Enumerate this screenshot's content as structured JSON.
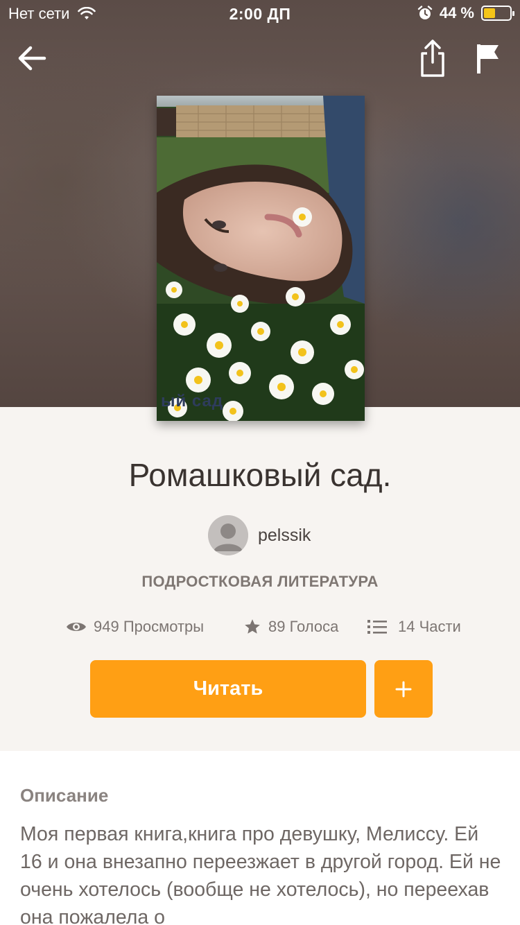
{
  "status_bar": {
    "carrier": "Нет сети",
    "time": "2:00 ДП",
    "battery_percent": "44 %",
    "battery_level": 0.44
  },
  "nav": {
    "back_icon": "arrow-left-icon",
    "share_icon": "share-icon",
    "report_icon": "flag-icon"
  },
  "cover": {
    "caption": "ый сад"
  },
  "book": {
    "title": "Ромашковый сад.",
    "author": "pelssik",
    "category": "ПОДРОСТКОВАЯ ЛИТЕРАТУРА"
  },
  "stats": {
    "views": "949 Просмотры",
    "votes": "89 Голоса",
    "parts": "14 Части"
  },
  "actions": {
    "read_label": "Читать",
    "add_label": "+"
  },
  "description": {
    "heading": "Описание",
    "text": "Моя первая книга,книга про девушку, Мелиссу. Ей 16 и она внезапно переезжает в другой город. Ей не очень хотелось (вообще не хотелось), но переехав она пожалела о"
  },
  "colors": {
    "accent": "#ff9f14",
    "background": "#f7f4f1"
  }
}
